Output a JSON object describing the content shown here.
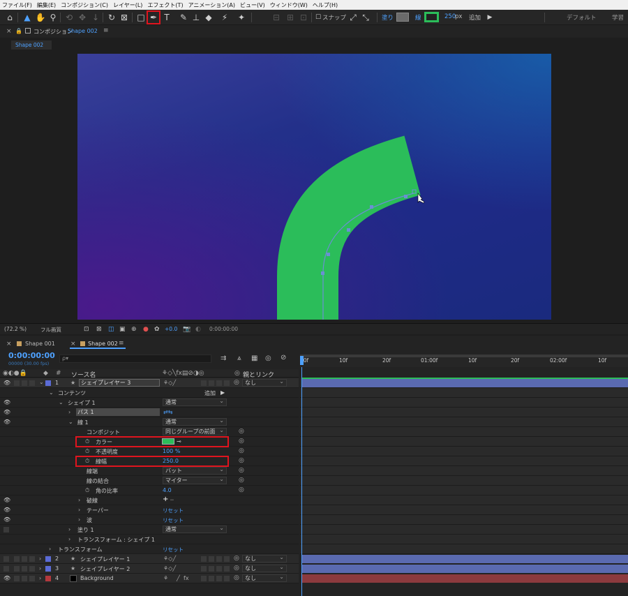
{
  "menu": [
    "ファイル(F)",
    "編集(E)",
    "コンポジション(C)",
    "レイヤー(L)",
    "エフェクト(T)",
    "アニメーション(A)",
    "ビュー(V)",
    "ウィンドウ(W)",
    "ヘルプ(H)"
  ],
  "toolbar": {
    "snap_label": "スナップ",
    "fill_label": "塗り",
    "stroke_label": "線",
    "stroke_width": "250",
    "stroke_unit": "px",
    "add_label": "追加",
    "workspace_default": "デフォルト",
    "workspace_learn": "学習",
    "fill_color": "#6a6a6a",
    "stroke_color": "#2bbd5a"
  },
  "comp_panel": {
    "prefix": "コンポジション",
    "comp_name": "Shape 002",
    "subtab": "Shape 002"
  },
  "viewer_bar": {
    "zoom": "(72.2 %)",
    "quality": "フル画質",
    "exposure": "+0.0",
    "timecode": "0:00:00:00"
  },
  "timeline": {
    "tabs": [
      "Shape 001",
      "Shape 002"
    ],
    "timecode": "0:00:00:00",
    "timecode_sub": "00000 (30.00 fps)",
    "search_placeholder": "ρ▾",
    "header": {
      "num": "#",
      "source_name": "ソース名",
      "parent": "親とリンク"
    },
    "ruler": [
      "00f",
      "10f",
      "20f",
      "01:00f",
      "10f",
      "20f",
      "02:00f",
      "10f"
    ],
    "none": "なし",
    "rows": {
      "layer1_num": "1",
      "layer1_name": "シェイプレイヤー 3",
      "contents": "コンテンツ",
      "add": "追加",
      "shape1": "シェイプ 1",
      "normal1": "通常",
      "path1": "パス 1",
      "stroke1": "線 1",
      "normal2": "通常",
      "composite": "コンポジット",
      "composite_val": "同じグループの前面",
      "color": "カラー",
      "opacity": "不透明度",
      "opacity_val": "100 %",
      "stroke_width": "線幅",
      "stroke_width_val": "250.0",
      "line_cap": "線端",
      "line_cap_val": "バット",
      "line_join": "線の結合",
      "line_join_val": "マイター",
      "miter": "角の比率",
      "miter_val": "4.0",
      "dashes": "破線",
      "dash_plus": "+",
      "taper": "テーパー",
      "reset1": "リセット",
      "wave": "波",
      "reset2": "リセット",
      "fill1": "塗り 1",
      "normal3": "通常",
      "transform_shape": "トランスフォーム : シェイプ 1",
      "transform": "トランスフォーム",
      "reset3": "リセット",
      "layer2_num": "2",
      "layer2_name": "シェイプレイヤー 1",
      "layer3_num": "3",
      "layer3_name": "シェイプレイヤー 2",
      "layer4_num": "4",
      "layer4_name": "Background",
      "fx": "fx"
    },
    "colors": {
      "layer_blue": "#5b6bd6",
      "layer_red": "#b3383d",
      "shape_green": "#2bbd5a",
      "bar_blue": "#5a6ab0",
      "bar_red": "#8c3a3e"
    }
  }
}
